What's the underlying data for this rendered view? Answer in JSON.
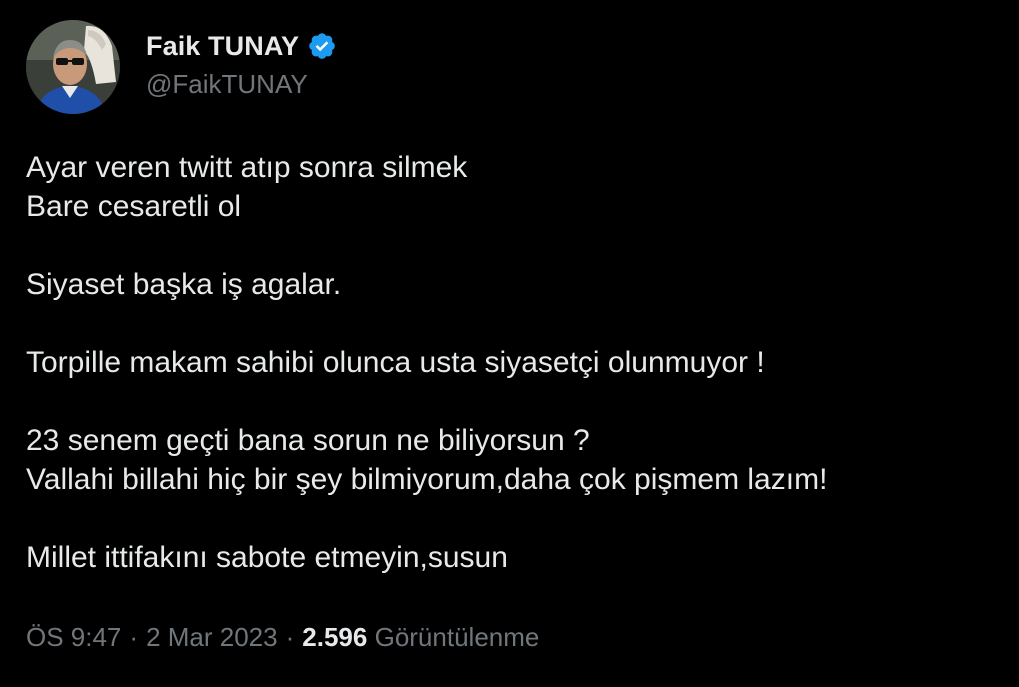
{
  "author": {
    "display_name": "Faik TUNAY",
    "handle": "@FaikTUNAY",
    "verified_badge_icon": "verified-badge-icon",
    "verified_color": "#1d9bf0"
  },
  "tweet": {
    "paragraphs": [
      [
        "Ayar veren twitt atıp sonra silmek",
        "Bare cesaretli ol"
      ],
      [
        "Siyaset başka iş agalar."
      ],
      [
        "Torpille makam sahibi olunca usta siyasetçi olunmuyor !"
      ],
      [
        "23 senem geçti bana sorun ne biliyorsun ?",
        "Vallahi billahi hiç bir şey bilmiyorum,daha çok pişmem lazım!"
      ],
      [
        "Millet ittifakını sabote etmeyin,susun"
      ]
    ]
  },
  "meta": {
    "time": "ÖS 9:47",
    "separator": "·",
    "date": "2 Mar 2023",
    "views_count": "2.596",
    "views_label": "Görüntülenme"
  },
  "colors": {
    "background": "#000000",
    "text_primary": "#e7e9ea",
    "text_secondary": "#71767b"
  }
}
